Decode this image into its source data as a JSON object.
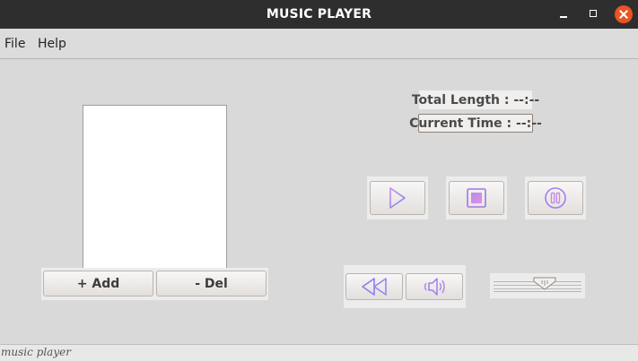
{
  "window": {
    "title": "MUSIC PLAYER"
  },
  "menu": {
    "file": "File",
    "help": "Help"
  },
  "playlist": {
    "items": []
  },
  "playlist_buttons": {
    "add": "+ Add",
    "del": "- Del"
  },
  "info": {
    "total_length": "Total Length : --:--",
    "current_time": "Current Time : --:--"
  },
  "controls": {
    "play_icon": "play-icon",
    "stop_icon": "stop-icon",
    "pause_icon": "pause-icon",
    "rewind_icon": "rewind-icon",
    "volume_icon": "volume-icon",
    "icon_color": "#a97cf0"
  },
  "status": {
    "text": "music player"
  }
}
